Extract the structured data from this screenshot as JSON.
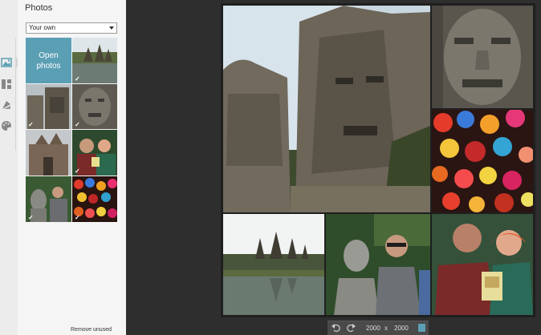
{
  "panel": {
    "title": "Photos",
    "layout_select": "Your own",
    "open_button": "Open photos",
    "remove_unused": "Remove unused",
    "check_mark": "✓"
  },
  "rail": {
    "icons": [
      "photos-icon",
      "layout-icon",
      "stickers-icon",
      "palette-icon"
    ]
  },
  "toolbar": {
    "width": "2000",
    "separator": "x",
    "height": "2000"
  },
  "colors": {
    "accent": "#5b9fb5",
    "panel_bg": "#f5f5f5",
    "canvas_bg": "#2e2e2e"
  }
}
